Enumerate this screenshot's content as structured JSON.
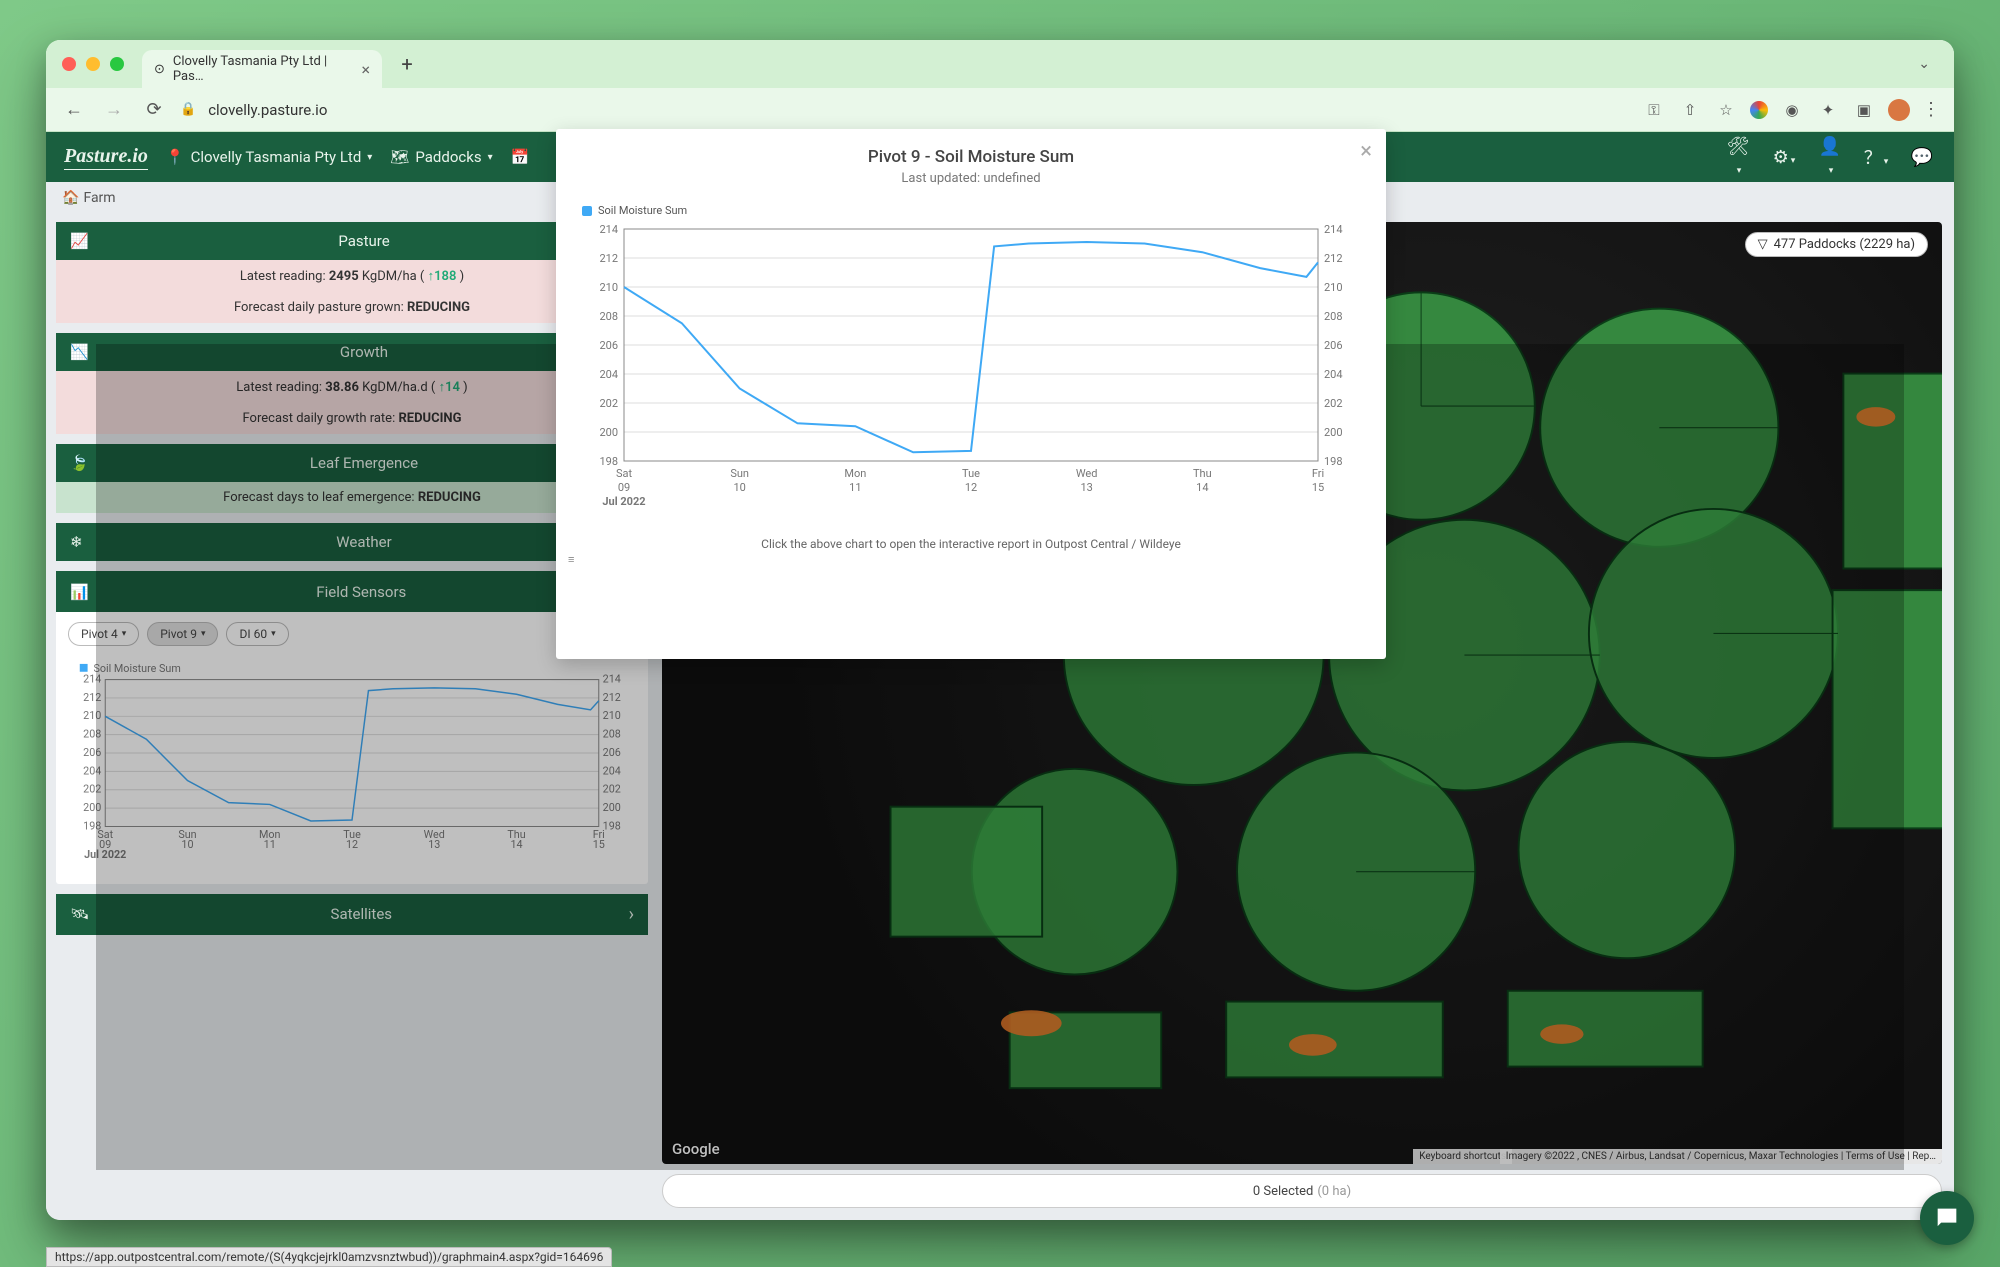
{
  "browser": {
    "tab_title": "Clovelly Tasmania Pty Ltd | Pas…",
    "url": "clovelly.pasture.io"
  },
  "toolbar": {
    "logo": "Pasture.io",
    "farm_dropdown": "Clovelly Tasmania Pty Ltd",
    "paddocks_label": "Paddocks"
  },
  "breadcrumb": {
    "item": "Farm"
  },
  "sidebar": {
    "pasture": {
      "title": "Pasture",
      "latest_label": "Latest reading:",
      "latest_value": "2495",
      "latest_unit": "KgDM/ha (",
      "delta": "188",
      "close": ")",
      "forecast_label": "Forecast daily pasture grown:",
      "forecast_val": "REDUCING"
    },
    "growth": {
      "title": "Growth",
      "latest_label": "Latest reading:",
      "latest_value": "38.86",
      "latest_unit": "KgDM/ha.d (",
      "delta": "14",
      "close": ")",
      "forecast_label": "Forecast daily growth rate:",
      "forecast_val": "REDUCING"
    },
    "leaf": {
      "title": "Leaf Emergence",
      "forecast_label": "Forecast days to leaf emergence:",
      "forecast_val": "REDUCING"
    },
    "weather": {
      "title": "Weather"
    },
    "sensors": {
      "title": "Field Sensors",
      "chips": [
        "Pivot 4",
        "Pivot 9",
        "DI 60"
      ],
      "chart_legend": "Soil Moisture Sum"
    },
    "satellites": {
      "title": "Satellites"
    }
  },
  "map": {
    "paddock_badge_prefix": "▽ ",
    "paddock_badge": "477 Paddocks (2229 ha)",
    "google": "Google",
    "kb": "Keyboard shortcuts",
    "attrib": "Imagery ©2022 , CNES / Airbus, Landsat / Copernicus, Maxar Technologies",
    "terms": "Terms of Use",
    "report": "Rep…"
  },
  "footer": {
    "selected": "0 Selected",
    "ha": "(0 ha)"
  },
  "modal": {
    "title": "Pivot 9 - Soil Moisture Sum",
    "subtitle": "Last updated: undefined",
    "legend": "Soil Moisture Sum",
    "hint": "Click the above chart to open the interactive report in Outpost Central / Wildeye"
  },
  "chart_data": {
    "type": "line",
    "title": "Soil Moisture Sum",
    "ylabel": "",
    "ylim": [
      198,
      214
    ],
    "y_ticks": [
      198,
      200,
      202,
      204,
      206,
      208,
      210,
      212,
      214
    ],
    "categories": [
      "Sat 09",
      "Sun 10",
      "Mon 11",
      "Tue 12",
      "Wed 13",
      "Thu 14",
      "Fri 15"
    ],
    "x_sublabel": "Jul 2022",
    "series": [
      {
        "name": "Soil Moisture Sum",
        "values": [
          210.0,
          207.5,
          203.0,
          200.6,
          200.4,
          198.6,
          198.7,
          212.8,
          213.0,
          213.1,
          213.0,
          212.4,
          211.3,
          210.7,
          211.7
        ],
        "x_index": [
          0,
          0.5,
          1,
          1.5,
          2,
          2.5,
          3,
          3.2,
          3.5,
          4,
          4.5,
          5,
          5.5,
          5.9,
          6
        ]
      }
    ]
  },
  "status_hover": "https://app.outpostcentral.com/remote/(S(4yqkcjejrkl0amzvsnztwbud))/graphmain4.aspx?gid=164696"
}
